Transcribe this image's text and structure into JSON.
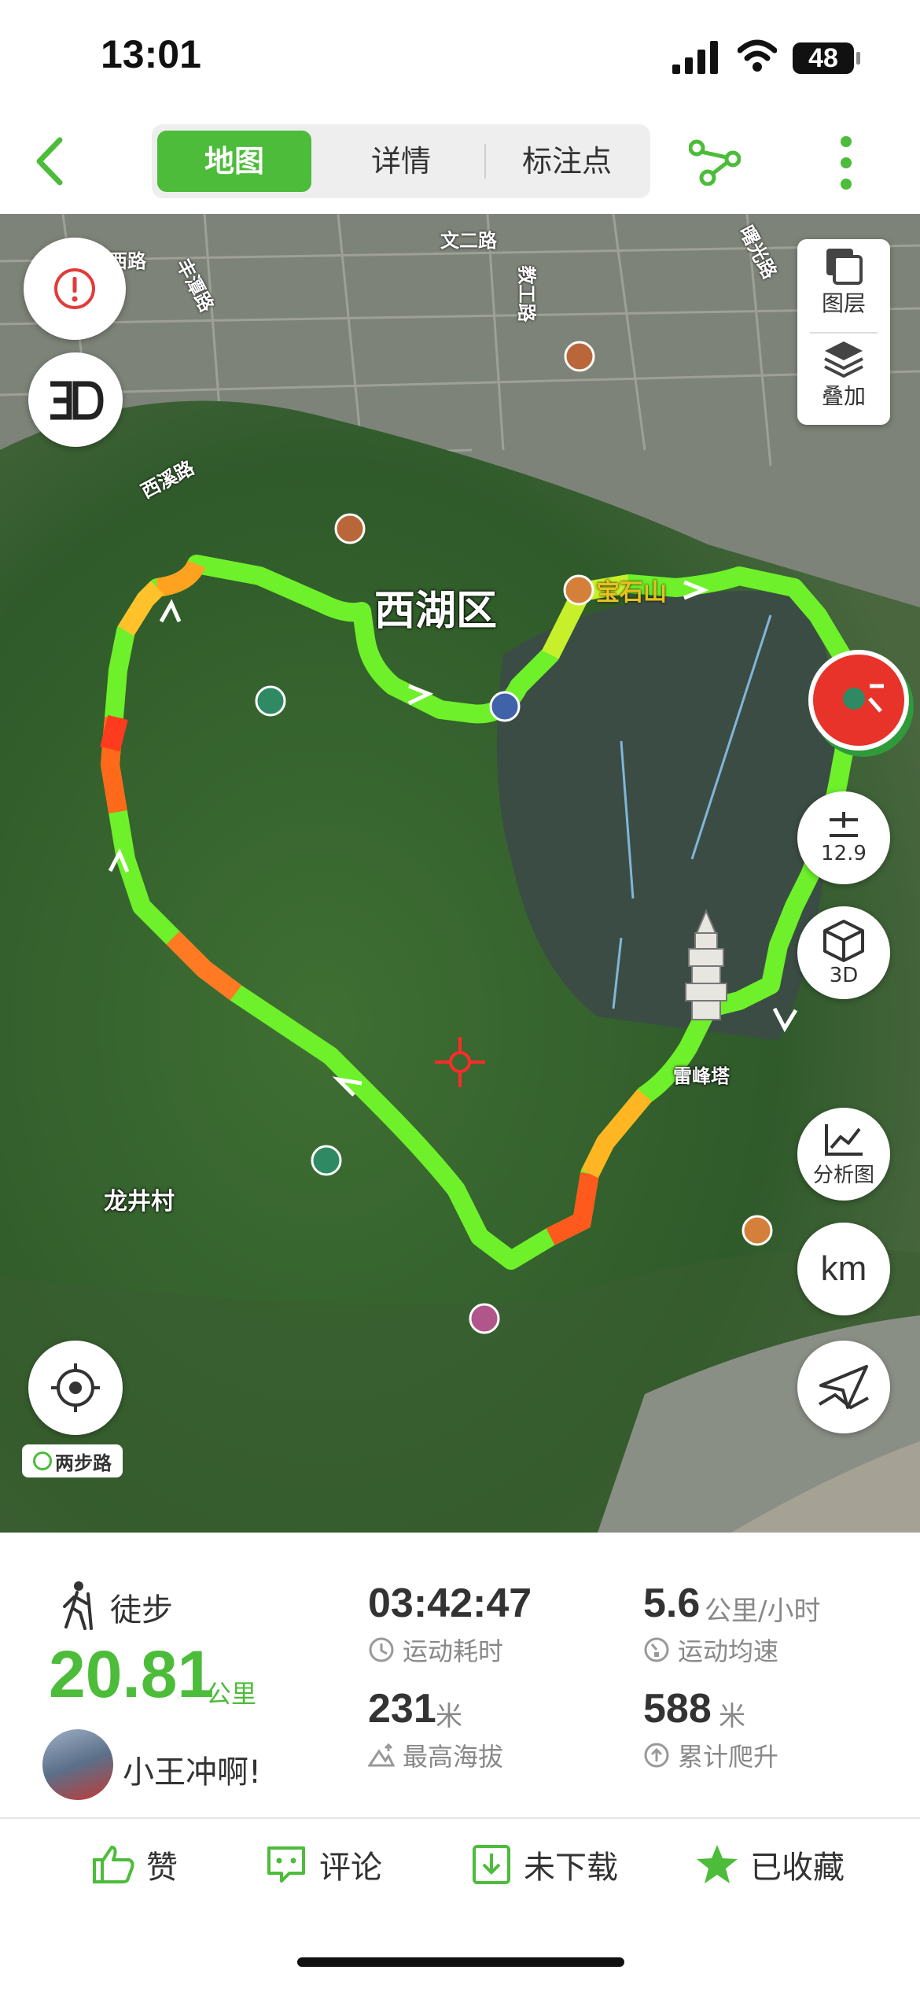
{
  "status": {
    "time": "13:01",
    "battery": "48"
  },
  "nav": {
    "tabs": [
      "地图",
      "详情",
      "标注点"
    ],
    "active_tab": "地图"
  },
  "map": {
    "layers_label": "图层",
    "overlay_label": "叠加",
    "zoom_level": "12.9",
    "threed_label": "3D",
    "analysis_label": "分析图",
    "unit_label": "km",
    "district_label": "西湖区",
    "mountain_label": "宝石山",
    "pagoda_label": "雷峰塔",
    "village_label": "龙井村",
    "brand_label": "两步路",
    "road_labels": [
      "西路",
      "丰潭路",
      "文二路",
      "教工路",
      "西溪路",
      "曙光路"
    ]
  },
  "activity": {
    "type": "徒步",
    "distance": "20.81",
    "distance_unit": "公里",
    "user": "小王冲啊!",
    "duration": "03:42:47",
    "duration_label": "运动耗时",
    "avg_speed": "5.6",
    "avg_speed_unit": "公里/小时",
    "avg_speed_label": "运动均速",
    "max_altitude": "231",
    "max_altitude_unit": "米",
    "max_altitude_label": "最高海拔",
    "total_climb": "588",
    "total_climb_unit": "米",
    "total_climb_label": "累计爬升"
  },
  "actions": {
    "like": "赞",
    "comment": "评论",
    "download": "未下载",
    "favorite": "已收藏"
  },
  "colors": {
    "accent": "#4cbc3a",
    "track_fast": "#6ef02a",
    "track_slow": "#ff3b1f"
  }
}
